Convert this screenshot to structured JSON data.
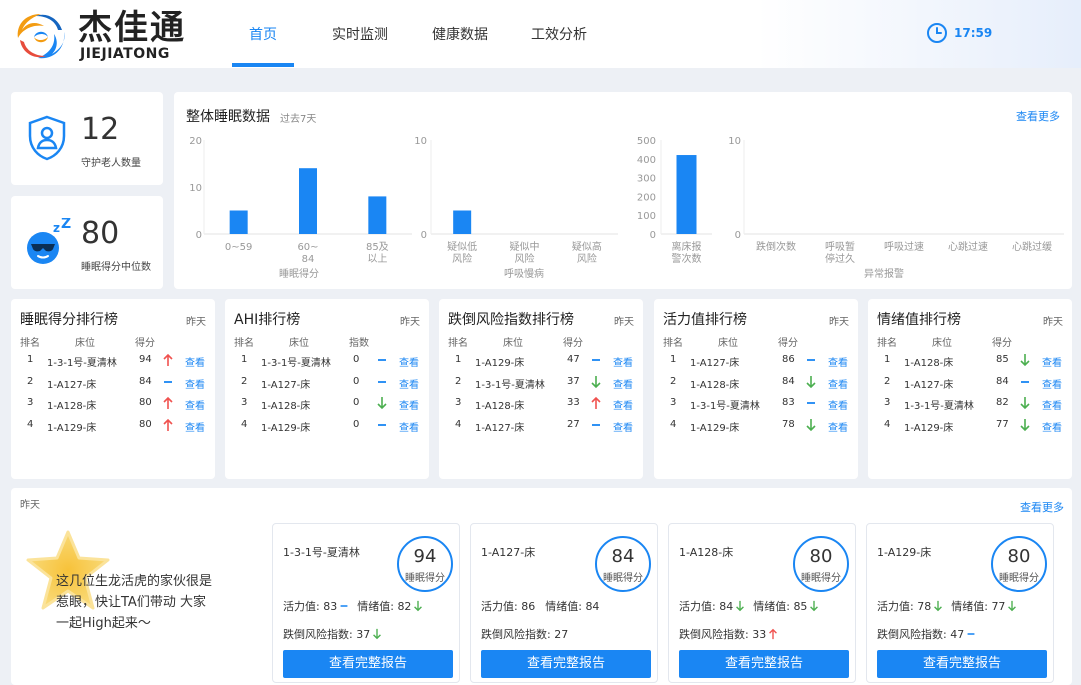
{
  "brand": {
    "cn": "杰佳通",
    "en": "JIEJIATONG",
    "colors": {
      "blue": "#1a86f3",
      "orange": "#f39c12",
      "red": "#e74c3c",
      "green": "#4caf50"
    }
  },
  "nav": [
    {
      "label": "首页",
      "active": true
    },
    {
      "label": "实时监测"
    },
    {
      "label": "健康数据"
    },
    {
      "label": "工效分析"
    }
  ],
  "clock": {
    "time": "17:59"
  },
  "stats": {
    "guarded": {
      "value": "12",
      "label": "守护老人数量",
      "icon": "shield-user-icon"
    },
    "sleep_median": {
      "value": "80",
      "label": "睡眠得分中位数",
      "icon": "sleeping-face-icon"
    }
  },
  "sleep_overview": {
    "title": "整体睡眠数据",
    "subtitle": "过去7天",
    "more": "查看更多"
  },
  "chart_data": [
    {
      "type": "bar",
      "xlabel": "睡眠得分",
      "categories": [
        "0~59",
        "60~84",
        "85及以上"
      ],
      "values": [
        5,
        14,
        8
      ],
      "ylim": [
        0,
        20
      ],
      "yticks": [
        "0",
        "10",
        "20"
      ]
    },
    {
      "type": "bar",
      "xlabel": "呼吸慢病",
      "categories": [
        "疑似低风险",
        "疑似中风险",
        "疑似高风险"
      ],
      "values": [
        2.5,
        0,
        0
      ],
      "ylim": [
        0,
        10
      ],
      "yticks": [
        "0",
        "10"
      ]
    },
    {
      "type": "bar",
      "xlabel": "",
      "categories": [
        "离床报警次数"
      ],
      "values": [
        420
      ],
      "ylim": [
        0,
        500
      ],
      "yticks": [
        "0",
        "100",
        "200",
        "300",
        "400",
        "500"
      ]
    },
    {
      "type": "bar",
      "xlabel": "异常报警",
      "categories": [
        "跌倒次数",
        "呼吸暂停过久",
        "呼吸过速",
        "心跳过速",
        "心跳过缓"
      ],
      "values": [
        0,
        0,
        0,
        0,
        0
      ],
      "ylim": [
        0,
        10
      ],
      "yticks": [
        "0",
        "10"
      ]
    }
  ],
  "rankings": [
    {
      "title": "睡眠得分排行榜",
      "period": "昨天",
      "headers": [
        "排名",
        "床位",
        "得分"
      ],
      "rows": [
        {
          "rank": "1",
          "bed": "1-3-1号-夏清林",
          "value": "94",
          "trend": "up",
          "action": "查看"
        },
        {
          "rank": "2",
          "bed": "1-A127-床",
          "value": "84",
          "trend": "flat",
          "action": "查看"
        },
        {
          "rank": "3",
          "bed": "1-A128-床",
          "value": "80",
          "trend": "up",
          "action": "查看"
        },
        {
          "rank": "4",
          "bed": "1-A129-床",
          "value": "80",
          "trend": "up",
          "action": "查看"
        }
      ]
    },
    {
      "title": "AHI排行榜",
      "period": "昨天",
      "headers": [
        "排名",
        "床位",
        "指数"
      ],
      "rows": [
        {
          "rank": "1",
          "bed": "1-3-1号-夏清林",
          "value": "0",
          "trend": "flat",
          "action": "查看"
        },
        {
          "rank": "2",
          "bed": "1-A127-床",
          "value": "0",
          "trend": "flat",
          "action": "查看"
        },
        {
          "rank": "3",
          "bed": "1-A128-床",
          "value": "0",
          "trend": "down",
          "action": "查看"
        },
        {
          "rank": "4",
          "bed": "1-A129-床",
          "value": "0",
          "trend": "flat",
          "action": "查看"
        }
      ]
    },
    {
      "title": "跌倒风险指数排行榜",
      "period": "昨天",
      "headers": [
        "排名",
        "床位",
        "得分"
      ],
      "rows": [
        {
          "rank": "1",
          "bed": "1-A129-床",
          "value": "47",
          "trend": "flat",
          "action": "查看"
        },
        {
          "rank": "2",
          "bed": "1-3-1号-夏清林",
          "value": "37",
          "trend": "down",
          "action": "查看"
        },
        {
          "rank": "3",
          "bed": "1-A128-床",
          "value": "33",
          "trend": "up",
          "action": "查看"
        },
        {
          "rank": "4",
          "bed": "1-A127-床",
          "value": "27",
          "trend": "flat",
          "action": "查看"
        }
      ]
    },
    {
      "title": "活力值排行榜",
      "period": "昨天",
      "headers": [
        "排名",
        "床位",
        "得分"
      ],
      "rows": [
        {
          "rank": "1",
          "bed": "1-A127-床",
          "value": "86",
          "trend": "flat",
          "action": "查看"
        },
        {
          "rank": "2",
          "bed": "1-A128-床",
          "value": "84",
          "trend": "down",
          "action": "查看"
        },
        {
          "rank": "3",
          "bed": "1-3-1号-夏清林",
          "value": "83",
          "trend": "flat",
          "action": "查看"
        },
        {
          "rank": "4",
          "bed": "1-A129-床",
          "value": "78",
          "trend": "down",
          "action": "查看"
        }
      ]
    },
    {
      "title": "情绪值排行榜",
      "period": "昨天",
      "headers": [
        "排名",
        "床位",
        "得分"
      ],
      "rows": [
        {
          "rank": "1",
          "bed": "1-A128-床",
          "value": "85",
          "trend": "down",
          "action": "查看"
        },
        {
          "rank": "2",
          "bed": "1-A127-床",
          "value": "84",
          "trend": "flat",
          "action": "查看"
        },
        {
          "rank": "3",
          "bed": "1-3-1号-夏清林",
          "value": "82",
          "trend": "down",
          "action": "查看"
        },
        {
          "rank": "4",
          "bed": "1-A129-床",
          "value": "77",
          "trend": "down",
          "action": "查看"
        }
      ]
    }
  ],
  "highlight": {
    "period": "昨天",
    "more": "查看更多",
    "message": "这几位生龙活虎的家伙很是惹眼，快让TA们带动 大家一起High起来～",
    "score_label": "睡眠得分",
    "vitality_label": "活力值:",
    "mood_label": "情绪值:",
    "fall_label": "跌倒风险指数:",
    "button_label": "查看完整报告",
    "people": [
      {
        "name": "1-3-1号-夏清林",
        "score": "94",
        "vitality": "83",
        "vitality_trend": "flat",
        "mood": "82",
        "mood_trend": "down",
        "fall": "37",
        "fall_trend": "down"
      },
      {
        "name": "1-A127-床",
        "score": "84",
        "vitality": "86",
        "vitality_trend": "none",
        "mood": "84",
        "mood_trend": "none",
        "fall": "27",
        "fall_trend": "none"
      },
      {
        "name": "1-A128-床",
        "score": "80",
        "vitality": "84",
        "vitality_trend": "down",
        "mood": "85",
        "mood_trend": "down",
        "fall": "33",
        "fall_trend": "up"
      },
      {
        "name": "1-A129-床",
        "score": "80",
        "vitality": "78",
        "vitality_trend": "down",
        "mood": "77",
        "mood_trend": "down",
        "fall": "47",
        "fall_trend": "flat"
      }
    ]
  }
}
